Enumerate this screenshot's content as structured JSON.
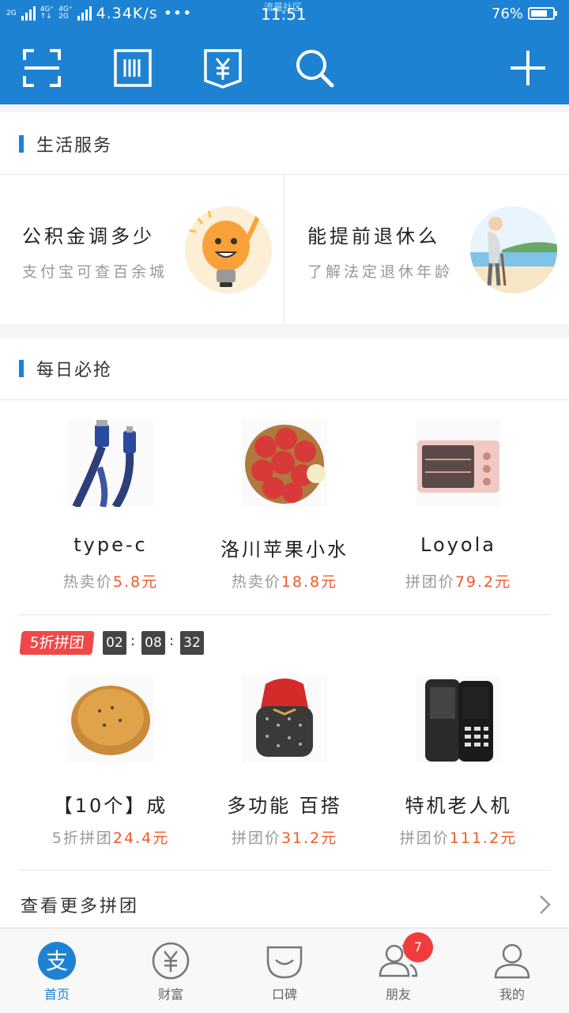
{
  "status": {
    "network_1": "2G",
    "network_2a": "4G⁺",
    "network_2b": "4G⁺",
    "network_2c": "2G",
    "speed": "4.34K/s •••",
    "carrier_overlay": "流量社区",
    "time": "11:51",
    "battery": "76%",
    "battery_level": 0.76
  },
  "topbar": {
    "icons": [
      "scan-icon",
      "barcode-icon",
      "yuan-card-icon",
      "search-icon",
      "plus-icon"
    ]
  },
  "life_service": {
    "title": "生活服务",
    "items": [
      {
        "title": "公积金调多少",
        "subtitle": "支付宝可查百余城"
      },
      {
        "title": "能提前退休么",
        "subtitle": "了解法定退休年龄"
      }
    ]
  },
  "daily_deals": {
    "title": "每日必抢",
    "products": [
      {
        "name": "type-c",
        "price_label": "热卖价",
        "price": "5.8元"
      },
      {
        "name": "洛川苹果小水",
        "price_label": "热卖价",
        "price": "18.8元"
      },
      {
        "name": "Loyola",
        "price_label": "拼团价",
        "price": "79.2元"
      }
    ]
  },
  "group_buy": {
    "tag": "5折拼团",
    "countdown": [
      "02",
      "08",
      "32"
    ],
    "products": [
      {
        "name": "【10个】成",
        "price_label": "5折拼团",
        "price": "24.4元"
      },
      {
        "name": "多功能 百搭",
        "price_label": "拼团价",
        "price": "31.2元"
      },
      {
        "name": "特机老人机",
        "price_label": "拼团价",
        "price": "111.2元"
      }
    ],
    "more": "查看更多拼团"
  },
  "tabbar": {
    "tabs": [
      {
        "label": "首页",
        "active": true
      },
      {
        "label": "财富"
      },
      {
        "label": "口碑"
      },
      {
        "label": "朋友",
        "badge": "7"
      },
      {
        "label": "我的"
      }
    ]
  },
  "colors": {
    "primary": "#1e82d2",
    "price": "#f05a28",
    "badge": "#f03c3c"
  }
}
